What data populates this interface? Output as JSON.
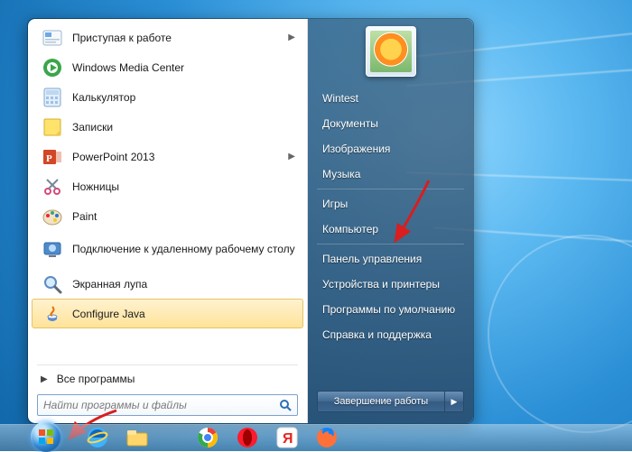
{
  "left": {
    "items": [
      {
        "label": "Приступая к работе",
        "submenu": true
      },
      {
        "label": "Windows Media Center"
      },
      {
        "label": "Калькулятор"
      },
      {
        "label": "Записки"
      },
      {
        "label": "PowerPoint 2013",
        "submenu": true
      },
      {
        "label": "Ножницы"
      },
      {
        "label": "Paint"
      },
      {
        "label": "Подключение к удаленному рабочему столу",
        "tall": true
      },
      {
        "label": "Экранная лупа"
      },
      {
        "label": "Configure Java",
        "highlight": true
      }
    ],
    "all_programs": "Все программы",
    "search_placeholder": "Найти программы и файлы"
  },
  "right": {
    "items": [
      "Wintest",
      "Документы",
      "Изображения",
      "Музыка",
      "Игры",
      "Компьютер",
      "Панель управления",
      "Устройства и принтеры",
      "Программы по умолчанию",
      "Справка и поддержка"
    ],
    "shutdown": "Завершение работы"
  }
}
